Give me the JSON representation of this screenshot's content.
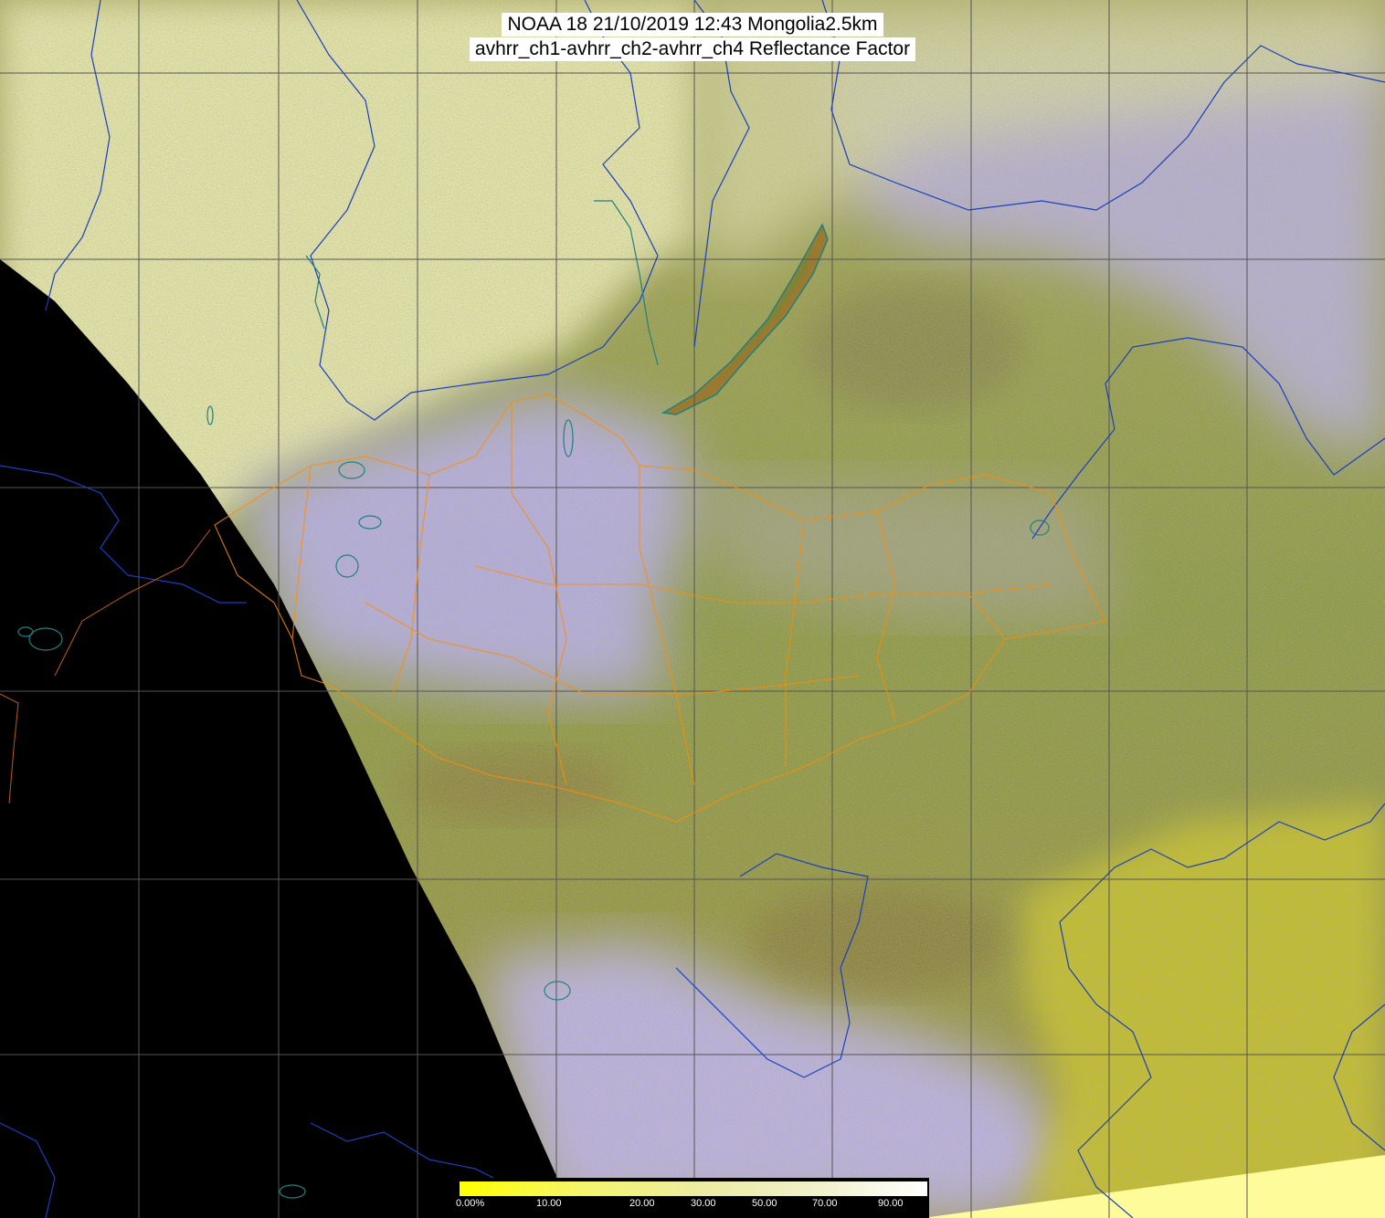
{
  "title": {
    "line1": "NOAA 18 21/10/2019 12:43 Mongolia2.5km",
    "line2": "avhrr_ch1-avhrr_ch2-avhrr_ch4 Reflectance Factor"
  },
  "colorbar": {
    "labels": [
      "0.00%",
      "10.00",
      "20.00",
      "30.00",
      "50.00",
      "70.00",
      "90.00"
    ],
    "colors": [
      "#ffff00",
      "#f5f56a",
      "#ececa0",
      "#f0f0c8",
      "#ffffff"
    ]
  },
  "colors": {
    "no_data": "#000000",
    "cloud_lavender": "#b9b2f0",
    "cloud_yellow": "#e4e7a6",
    "land_olive": "#8f9a48",
    "land_brown": "#8b7a3c",
    "land_yellow": "#c8c22a",
    "grid": "#555555",
    "border_orange": "#ff8c00",
    "rivers_blue": "#1a3fbf",
    "lakes_teal": "#1f8080"
  }
}
